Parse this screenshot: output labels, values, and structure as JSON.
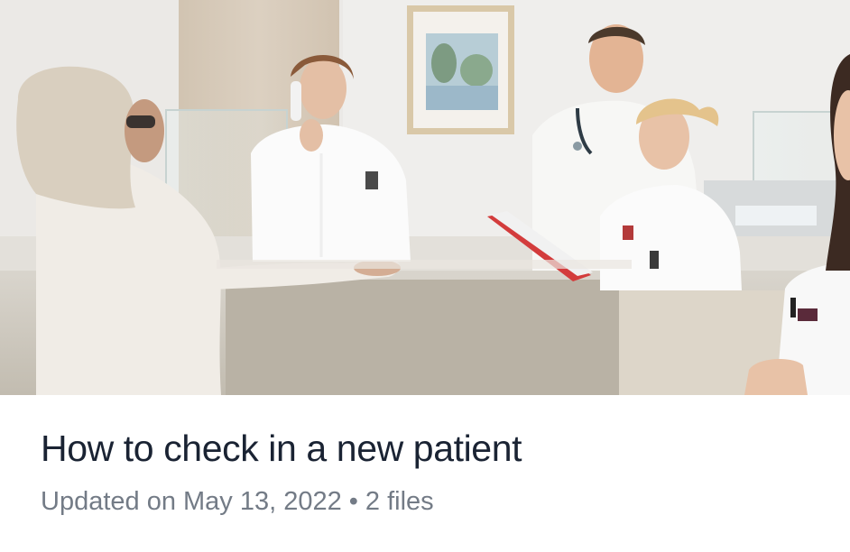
{
  "article": {
    "title": "How to check in a new patient",
    "updated": "Updated on May 13, 2022",
    "separator": "•",
    "files": "2 files"
  },
  "hero_image": {
    "subject": "reception-desk-photo"
  },
  "colors": {
    "title": "#1a2333",
    "meta": "#737b86",
    "background": "#ffffff"
  }
}
